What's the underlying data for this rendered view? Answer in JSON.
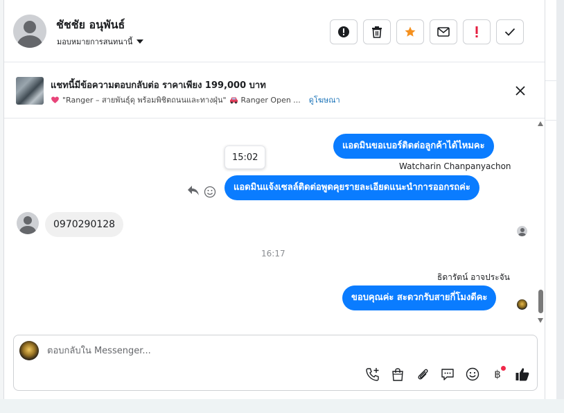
{
  "header": {
    "contact_name": "ชัชชัย อนุพันธ์",
    "assign_label": "มอบหมายการสนทนานี้"
  },
  "ad": {
    "title": "แชทนี้มีข้อความตอบกลับต่อ ราคาเพียง 199,000 บาท",
    "subtitle_part1": "\"Ranger – สายพันธุ์ดุ พร้อมพิชิตถนนและทางฝุ่น\"",
    "subtitle_part2": "Ranger Open ...",
    "link": "ดูโฆษณา"
  },
  "messages": {
    "out1": "แอดมินขอเบอร์ติดต่อลูกค้าได้ไหมคะ",
    "tooltip_time": "15:02",
    "sender1": "Watcharin Chanpanyachon",
    "out2": "แอดมินแจ้งเซลล์ติดต่อพูดคุยรายละเอียดแนะนำการออกรถค่ะ",
    "in1": "0970290128",
    "timestamp": "16:17",
    "sender2": "ธิดารัตน์ อาจประจัน",
    "out3": "ขอบคุณค่ะ สะดวกรับสายกี่โมงดีคะ"
  },
  "composer": {
    "placeholder": "ตอบกลับใน Messenger..."
  },
  "colors": {
    "accent": "#0a7cff",
    "star": "#f5901e",
    "alert": "#e41e3f",
    "link": "#1a73b8"
  }
}
